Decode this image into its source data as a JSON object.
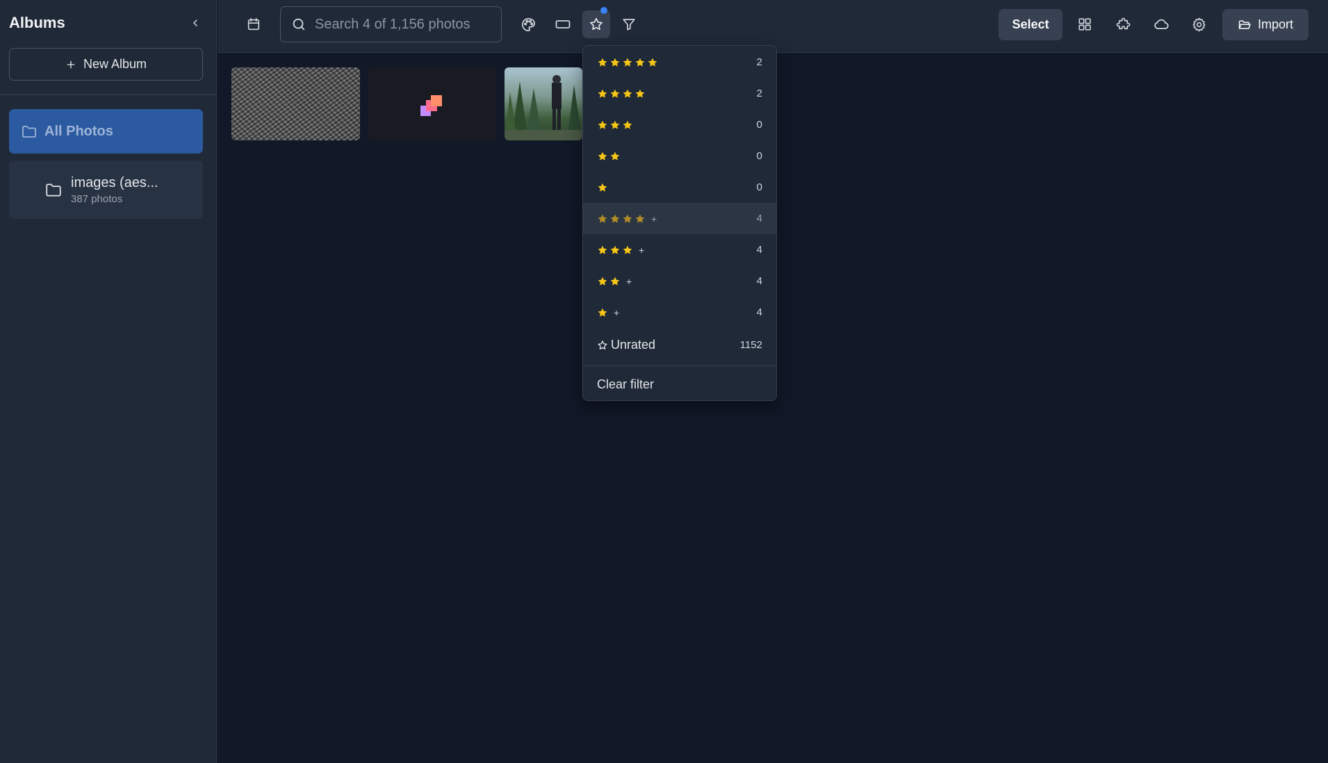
{
  "sidebar": {
    "title": "Albums",
    "new_album_label": "New Album",
    "all_photos_label": "All Photos",
    "albums": [
      {
        "name": "images (aes...",
        "count": "387 photos"
      }
    ]
  },
  "toolbar": {
    "search_placeholder": "Search 4 of 1,156 photos",
    "select_label": "Select",
    "import_label": "Import",
    "accent_color": "#3b82f6"
  },
  "rating_filter": {
    "star_color": "#f5c518",
    "items": [
      {
        "stars": 5,
        "plus": "",
        "count": "2"
      },
      {
        "stars": 4,
        "plus": "",
        "count": "2"
      },
      {
        "stars": 3,
        "plus": "",
        "count": "0"
      },
      {
        "stars": 2,
        "plus": "",
        "count": "0"
      },
      {
        "stars": 1,
        "plus": "",
        "count": "0"
      },
      {
        "stars": 4,
        "plus": "+",
        "count": "4"
      },
      {
        "stars": 3,
        "plus": "+",
        "count": "4"
      },
      {
        "stars": 2,
        "plus": "+",
        "count": "4"
      },
      {
        "stars": 1,
        "plus": "+",
        "count": "4"
      }
    ],
    "unrated_label": "Unrated",
    "unrated_count": "1152",
    "clear_label": "Clear filter"
  }
}
